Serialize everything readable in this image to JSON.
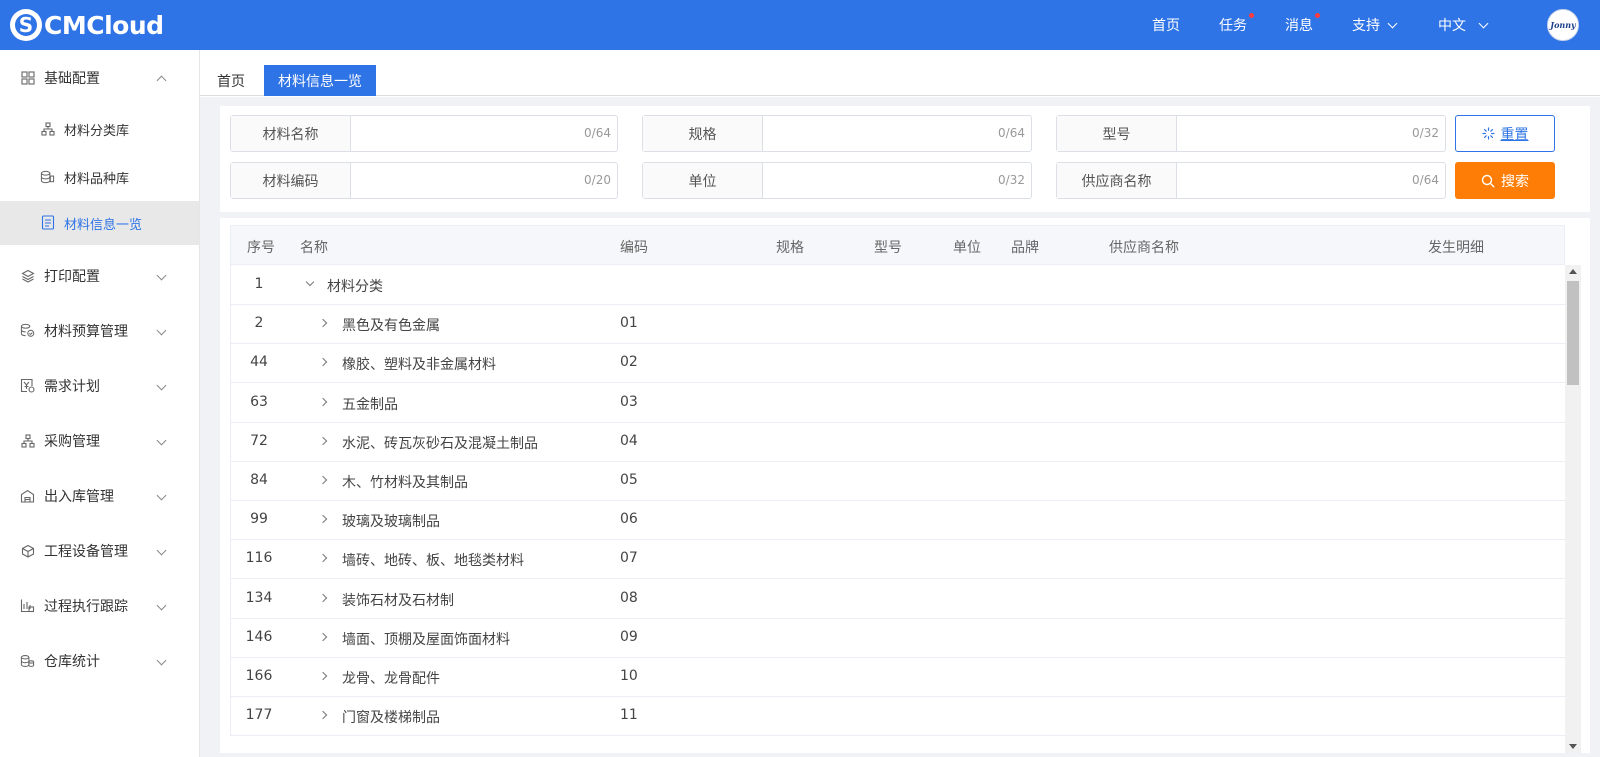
{
  "header": {
    "logo_text": "CMCloud",
    "nav": [
      {
        "label": "首页",
        "has_dot": false,
        "has_dropdown": false
      },
      {
        "label": "任务",
        "has_dot": true,
        "has_dropdown": false
      },
      {
        "label": "消息",
        "has_dot": true,
        "has_dropdown": false
      },
      {
        "label": "支持",
        "has_dot": false,
        "has_dropdown": true
      },
      {
        "label": "中文",
        "has_dot": false,
        "has_dropdown": true
      }
    ],
    "avatar_text": "Jonny"
  },
  "sidebar": {
    "items": [
      {
        "label": "基础配置",
        "icon": "grid-icon",
        "expanded": true
      },
      {
        "label": "材料分类库",
        "icon": "hierarchy-icon"
      },
      {
        "label": "材料品种库",
        "icon": "database-icon"
      },
      {
        "label": "材料信息一览",
        "icon": "document-icon",
        "active": true
      },
      {
        "label": "打印配置",
        "icon": "layers-icon"
      },
      {
        "label": "材料预算管理",
        "icon": "budget-icon"
      },
      {
        "label": "需求计划",
        "icon": "yen-icon"
      },
      {
        "label": "采购管理",
        "icon": "org-icon"
      },
      {
        "label": "出入库管理",
        "icon": "warehouse-icon"
      },
      {
        "label": "工程设备管理",
        "icon": "cube-icon"
      },
      {
        "label": "过程执行跟踪",
        "icon": "track-icon"
      },
      {
        "label": "仓库统计",
        "icon": "coins-icon"
      }
    ]
  },
  "tabs": [
    {
      "label": "首页",
      "active": false
    },
    {
      "label": "材料信息一览",
      "active": true
    }
  ],
  "filters": {
    "row1": [
      {
        "label": "材料名称",
        "value": "",
        "count": "0/64"
      },
      {
        "label": "规格",
        "value": "",
        "count": "0/64"
      },
      {
        "label": "型号",
        "value": "",
        "count": "0/32"
      }
    ],
    "row2": [
      {
        "label": "材料编码",
        "value": "",
        "count": "0/20"
      },
      {
        "label": "单位",
        "value": "",
        "count": "0/32"
      },
      {
        "label": "供应商名称",
        "value": "",
        "count": "0/64"
      }
    ],
    "reset_label": "重置",
    "search_label": "搜索"
  },
  "table": {
    "columns": [
      "序号",
      "名称",
      "编码",
      "规格",
      "型号",
      "单位",
      "品牌",
      "供应商名称",
      "发生明细"
    ],
    "rows": [
      {
        "no": "1",
        "name": "材料分类",
        "code": "",
        "level": 0,
        "expanded": true
      },
      {
        "no": "2",
        "name": "黑色及有色金属",
        "code": "01",
        "level": 1
      },
      {
        "no": "44",
        "name": "橡胶、塑料及非金属材料",
        "code": "02",
        "level": 1
      },
      {
        "no": "63",
        "name": "五金制品",
        "code": "03",
        "level": 1
      },
      {
        "no": "72",
        "name": "水泥、砖瓦灰砂石及混凝土制品",
        "code": "04",
        "level": 1
      },
      {
        "no": "84",
        "name": "木、竹材料及其制品",
        "code": "05",
        "level": 1
      },
      {
        "no": "99",
        "name": "玻璃及玻璃制品",
        "code": "06",
        "level": 1
      },
      {
        "no": "116",
        "name": "墙砖、地砖、板、地毯类材料",
        "code": "07",
        "level": 1
      },
      {
        "no": "134",
        "name": "装饰石材及石材制",
        "code": "08",
        "level": 1
      },
      {
        "no": "146",
        "name": "墙面、顶棚及屋面饰面材料",
        "code": "09",
        "level": 1
      },
      {
        "no": "166",
        "name": "龙骨、龙骨配件",
        "code": "10",
        "level": 1
      },
      {
        "no": "177",
        "name": "门窗及楼梯制品",
        "code": "11",
        "level": 1
      }
    ]
  },
  "colors": {
    "primary": "#2f74e6",
    "search_button": "#fe7d06",
    "notification_dot": "#ff3b3b"
  }
}
